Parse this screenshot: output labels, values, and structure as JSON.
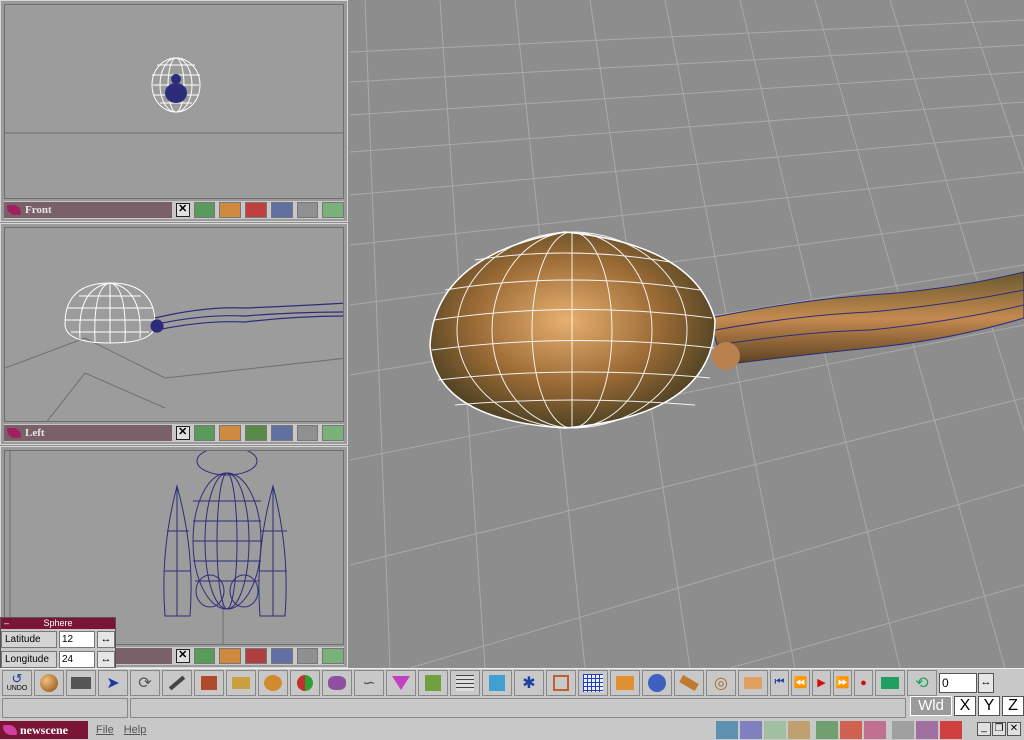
{
  "viewports": [
    {
      "name": "Front"
    },
    {
      "name": "Left"
    },
    {
      "name": ""
    }
  ],
  "viewport_close": "✕",
  "sphere_panel": {
    "title": "Sphere",
    "collapse": "–",
    "rows": [
      {
        "label": "Latitude",
        "value": "12"
      },
      {
        "label": "Longitude",
        "value": "24"
      }
    ],
    "arrow": "↔"
  },
  "toolbar": {
    "undo_label": "UNDO",
    "frame_value": "0",
    "frame_arrow": "↔"
  },
  "axes": {
    "wld": "Wld",
    "x": "X",
    "y": "Y",
    "z": "Z"
  },
  "taskbar": {
    "app_title": "newscene",
    "menus": [
      "File",
      "Help"
    ],
    "win_min": "_",
    "win_restore": "❐",
    "win_close": "✕"
  },
  "colors": {
    "accent": "#7b1535",
    "viewport_title": "#7a6068",
    "wireframe": "#2c2c7a"
  }
}
